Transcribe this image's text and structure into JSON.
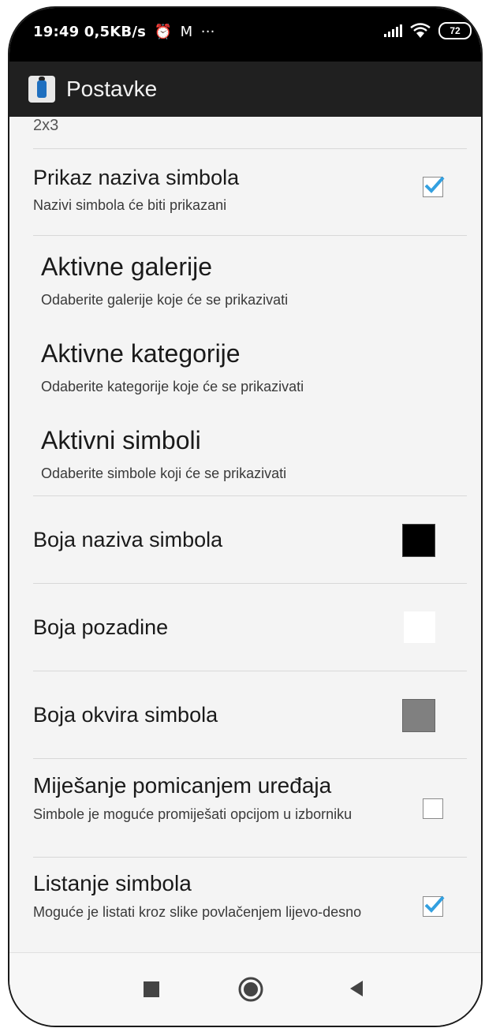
{
  "status": {
    "time": "19:49",
    "speed": "0,5KB/s",
    "icons": [
      "alarm-icon",
      "gmail-icon",
      "more-icon"
    ],
    "battery": "72"
  },
  "appbar": {
    "title": "Postavke"
  },
  "partial_top": "2x3",
  "settings": [
    {
      "title": "Prikaz naziva simbola",
      "subtitle": "Nazivi simbola će biti prikazani",
      "checked": true
    },
    {
      "title": "Aktivne galerije",
      "subtitle": "Odaberite galerije koje će se prikazivati"
    },
    {
      "title": "Aktivne kategorije",
      "subtitle": "Odaberite kategorije koje će se prikazivati"
    },
    {
      "title": "Aktivni simboli",
      "subtitle": "Odaberite simbole koji će se prikazivati"
    },
    {
      "title": "Boja naziva simbola",
      "color": "#000000"
    },
    {
      "title": "Boja pozadine",
      "color": "#ffffff"
    },
    {
      "title": "Boja okvira simbola",
      "color": "#808080"
    },
    {
      "title": "Miješanje pomicanjem uređaja",
      "subtitle": "Simbole je moguće promiješati opcijom u izborniku",
      "checked": false
    },
    {
      "title": "Listanje simbola",
      "subtitle": "Moguće je listati kroz slike povlačenjem lijevo-desno",
      "checked": true
    }
  ],
  "colors": {
    "accent": "#33a0e0",
    "appbar": "#202020",
    "statusbar": "#000000"
  }
}
